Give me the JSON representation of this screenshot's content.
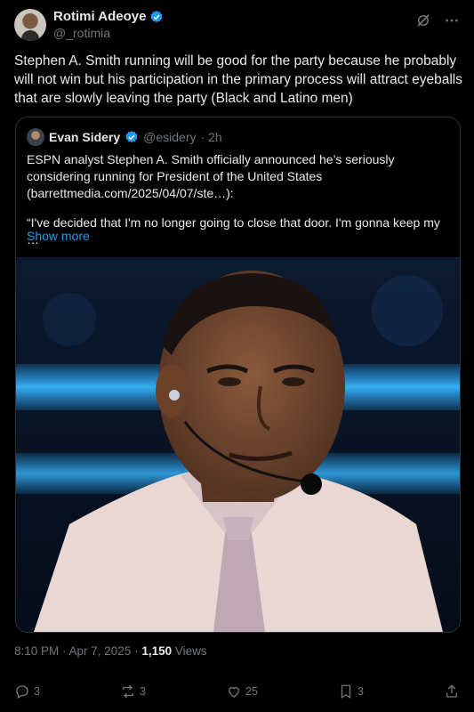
{
  "author": {
    "name": "Rotimi Adeoye",
    "handle": "@_rotimia"
  },
  "post": {
    "text": "Stephen A. Smith running will be good for the party because he probably will not win but his participation in the primary process will attract eyeballs that are slowly leaving the party (Black and Latino men)"
  },
  "quote": {
    "name": "Evan Sidery",
    "handle": "@esidery",
    "time": "· 2h",
    "text": "ESPN analyst Stephen A. Smith officially announced he’s seriously considering running for President of the United States (barrettmedia.com/2025/04/07/ste…):",
    "excerpt": "“I've decided that I'm no longer going to close that door. I'm gonna keep my …",
    "show_more": "Show more"
  },
  "meta": {
    "time": "8:10 PM · Apr 7, 2025 · ",
    "views_count": "1,150",
    "views_label": " Views"
  },
  "actions": {
    "replies": "3",
    "reposts": "3",
    "likes": "25",
    "bookmarks": "3"
  },
  "colors": {
    "background": "#000000",
    "text": "#e7e9ea",
    "muted": "#71767b",
    "accent": "#1d9bf0",
    "border": "#2f3336"
  },
  "icons": [
    "verified-badge-icon",
    "grok-icon",
    "more-icon",
    "reply-icon",
    "repost-icon",
    "like-icon",
    "bookmark-icon",
    "share-icon"
  ]
}
